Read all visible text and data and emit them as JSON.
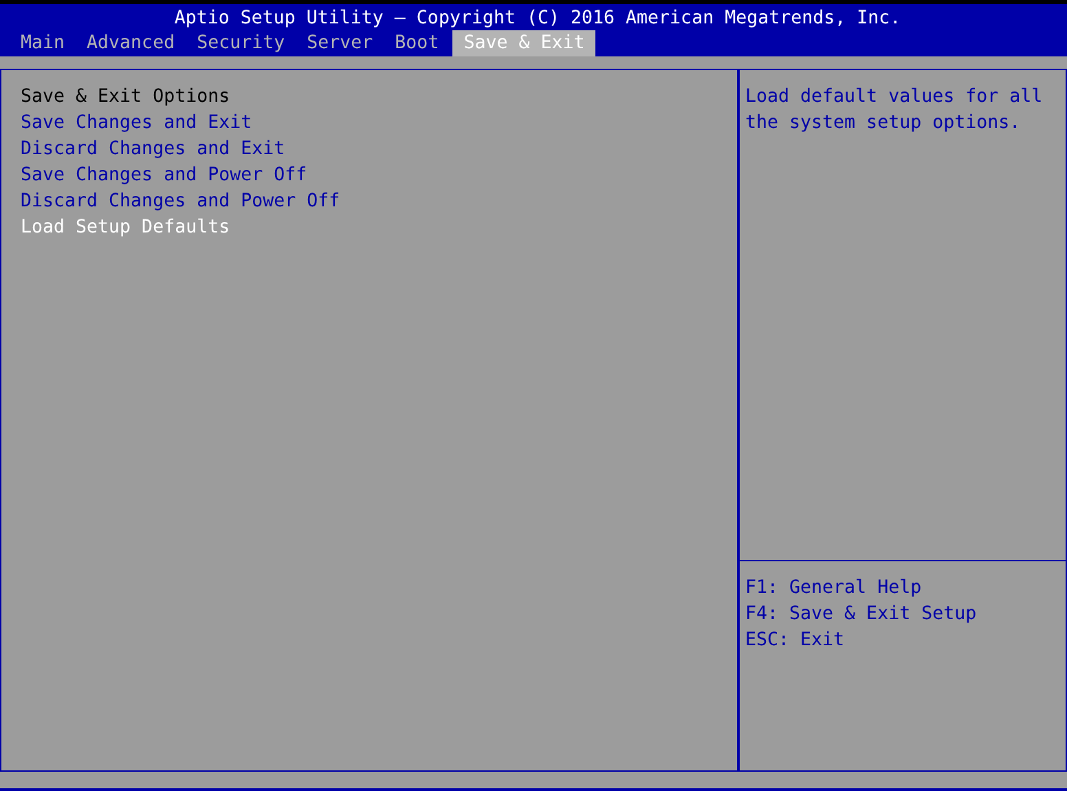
{
  "header": {
    "title": "Aptio Setup Utility – Copyright (C) 2016 American Megatrends, Inc."
  },
  "tabs": [
    {
      "label": "Main",
      "selected": false
    },
    {
      "label": "Advanced",
      "selected": false
    },
    {
      "label": "Security",
      "selected": false
    },
    {
      "label": "Server",
      "selected": false
    },
    {
      "label": "Boot",
      "selected": false
    },
    {
      "label": "Save & Exit",
      "selected": true
    }
  ],
  "menu": [
    {
      "label": "Save & Exit Options",
      "kind": "heading"
    },
    {
      "label": "Save Changes and Exit",
      "kind": "action",
      "selected": false
    },
    {
      "label": "Discard Changes and Exit",
      "kind": "action",
      "selected": false
    },
    {
      "label": "Save Changes and Power Off",
      "kind": "action",
      "selected": false
    },
    {
      "label": "Discard Changes and Power Off",
      "kind": "action",
      "selected": false
    },
    {
      "label": "Load Setup Defaults",
      "kind": "action",
      "selected": true
    }
  ],
  "help": {
    "text": "Load default values for all the system setup options."
  },
  "keys": [
    "F1: General Help",
    "F4: Save & Exit Setup",
    "ESC: Exit"
  ]
}
